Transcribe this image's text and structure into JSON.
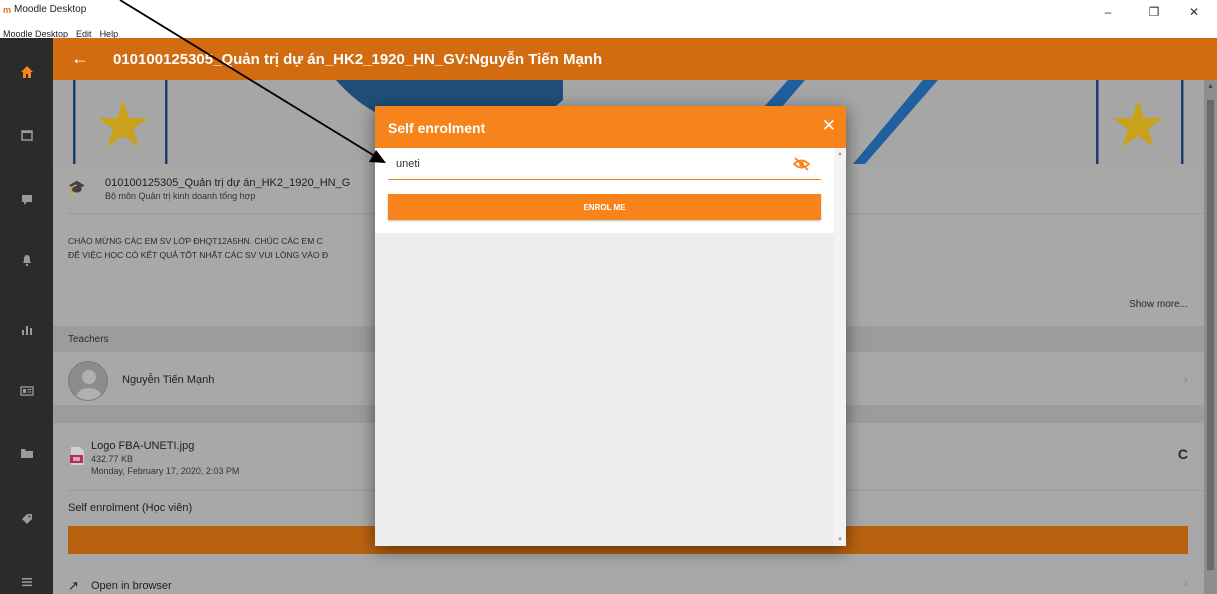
{
  "window": {
    "title": "Moodle Desktop",
    "minimize": "–",
    "restore": "❐",
    "close": "✕"
  },
  "menu": [
    "Moodle Desktop",
    "Edit",
    "Help"
  ],
  "header": {
    "back": "←",
    "title": "010100125305_Quản trị dự án_HK2_1920_HN_GV:Nguyễn Tiến Mạnh"
  },
  "course": {
    "name": "010100125305_Quản trị dự án_HK2_1920_HN_G",
    "department": "Bộ môn Quản trị kinh doanh tổng hợp",
    "desc_line1": "CHÀO MỪNG CÁC EM SV LỚP ĐHQT12A5HN. CHÚC CÁC EM C",
    "desc_line2": "ĐỂ VIỆC HỌC CÓ KẾT QUẢ TỐT NHẤT CÁC SV VUI LÒNG VÀO Đ",
    "show_more": "Show more..."
  },
  "teachers": {
    "section_label": "Teachers",
    "name": "Nguyễn Tiến Mạnh"
  },
  "file": {
    "name": "Logo FBA-UNETI.jpg",
    "size": "432.77 KB",
    "date": "Monday, February 17, 2020, 2:03 PM",
    "refresh": "C"
  },
  "self_enrolment_label": "Self enrolment (Học viên)",
  "open_in_browser": "Open in browser",
  "modal": {
    "title": "Self enrolment",
    "close": "✕",
    "password_value": "uneti",
    "button_label": "ENROL ME"
  },
  "colors": {
    "orange": "#f7841b",
    "header_orange": "#d36b10",
    "sidebar": "#2b2b2b"
  }
}
